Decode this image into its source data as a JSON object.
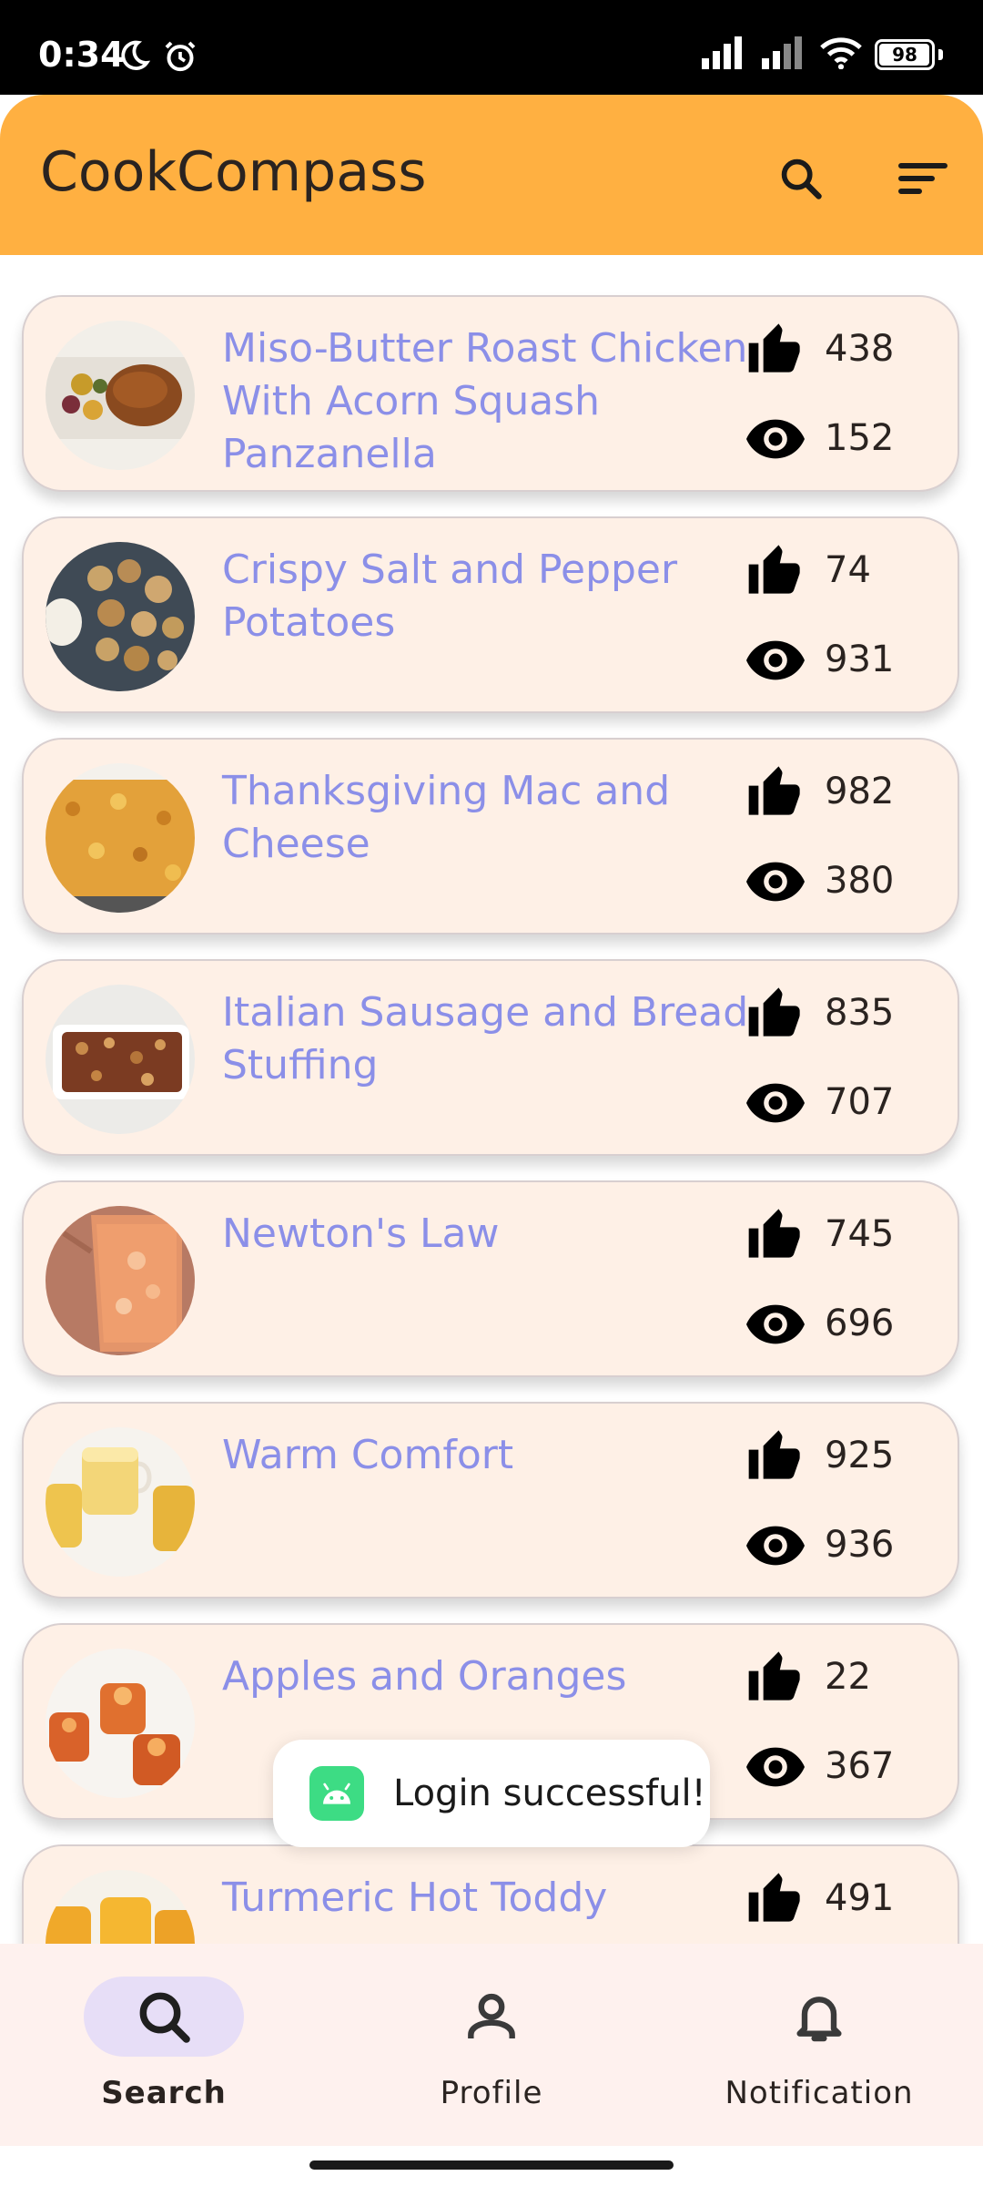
{
  "status_bar": {
    "time": "0:34",
    "battery": "98",
    "icons": [
      "moon-icon",
      "alarm-icon",
      "signal-icon",
      "signal-hd-icon",
      "wifi-icon",
      "battery-icon"
    ]
  },
  "app_bar": {
    "title": "CookCompass",
    "background_color": "#FFB041",
    "actions": [
      "search-icon",
      "sort-icon"
    ]
  },
  "recipes": [
    {
      "title": "Miso-Butter Roast Chicken With Acorn Squash Panzanella",
      "likes": "438",
      "views": "152",
      "thumb": "roast-chicken-image"
    },
    {
      "title": "Crispy Salt and Pepper Potatoes",
      "likes": "74",
      "views": "931",
      "thumb": "potatoes-image"
    },
    {
      "title": "Thanksgiving Mac and Cheese",
      "likes": "982",
      "views": "380",
      "thumb": "mac-and-cheese-image"
    },
    {
      "title": "Italian Sausage and Bread Stuffing",
      "likes": "835",
      "views": "707",
      "thumb": "stuffing-image"
    },
    {
      "title": "Newton's Law",
      "likes": "745",
      "views": "696",
      "thumb": "drink-image"
    },
    {
      "title": "Warm Comfort",
      "likes": "925",
      "views": "936",
      "thumb": "tea-image"
    },
    {
      "title": "Apples and Oranges",
      "likes": "22",
      "views": "367",
      "thumb": "orange-drinks-image"
    },
    {
      "title": "Turmeric Hot Toddy",
      "likes": "491",
      "views": "",
      "thumb": "turmeric-toddy-image"
    }
  ],
  "toast": {
    "message": "Login successful!"
  },
  "bottom_nav": {
    "items": [
      {
        "label": "Search",
        "icon": "search-icon",
        "active": true
      },
      {
        "label": "Profile",
        "icon": "person-icon",
        "active": false
      },
      {
        "label": "Notification",
        "icon": "bell-icon",
        "active": false
      }
    ]
  },
  "colors": {
    "card_bg": "#FEF0E6",
    "title_text": "#8B8FE8",
    "nav_bg": "#FEF1EE",
    "nav_active_pill": "#E7DEF7"
  }
}
